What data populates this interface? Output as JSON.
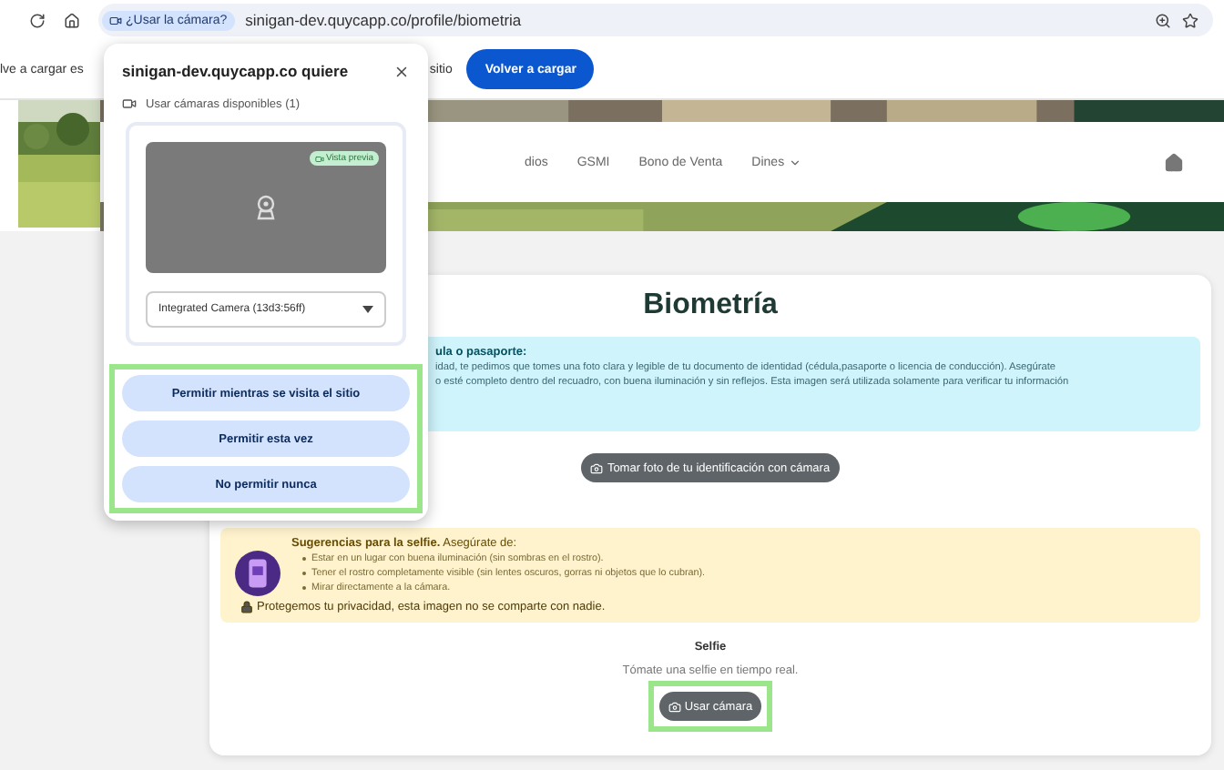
{
  "browser": {
    "permission_chip": "¿Usar la cámara?",
    "url": "sinigan-dev.quycapp.co/profile/biometria"
  },
  "infobar": {
    "text_left": "lve a cargar es",
    "text_right": "sitio",
    "button": "Volver a cargar"
  },
  "nav": {
    "items": [
      {
        "label": "dios",
        "has_menu": false
      },
      {
        "label": "GSMI",
        "has_menu": false
      },
      {
        "label": "Bono de Venta",
        "has_menu": false
      },
      {
        "label": "Dines",
        "has_menu": true
      }
    ]
  },
  "card": {
    "title": "Biometría",
    "id_notice": {
      "heading": "ula o pasaporte:",
      "lines": [
        "idad, te pedimos que tomes una foto clara y legible de tu documento de identidad (cédula,pasaporte o licencia de conducción). Asegúrate",
        "o esté completo dentro del recuadro, con buena iluminación y sin reflejos. Esta imagen será utilizada solamente para verificar tu información"
      ]
    },
    "id_button": "Tomar foto de tu identificación con cámara",
    "selfie_tips": {
      "heading": "**Sugerencias para la selfie.** Asegúrate de:",
      "items": [
        "Estar en un lugar con buena iluminación (sin sombras en el rostro).",
        "Tener el rostro completamente visible (sin lentes oscuros, gorras ni objetos que lo cubran).",
        "Mirar directamente a la cámara."
      ],
      "privacy": "Protegemos tu privacidad, esta imagen no se comparte con nadie."
    },
    "selfie_title": "Selfie",
    "selfie_subtitle": "Tómate una selfie en tiempo real.",
    "selfie_button": "Usar cámara",
    "selfie_button_highlighted": true
  },
  "popup": {
    "title": "sinigan-dev.quycapp.co quiere",
    "permission": "Usar cámaras disponibles (1)",
    "preview_badge": "Vista previa",
    "camera_select": "Integrated Camera (13d3:56ff)",
    "buttons": [
      "Permitir mientras se visita el sitio",
      "Permitir esta vez",
      "No permitir nunca"
    ],
    "buttons_highlighted": true
  }
}
